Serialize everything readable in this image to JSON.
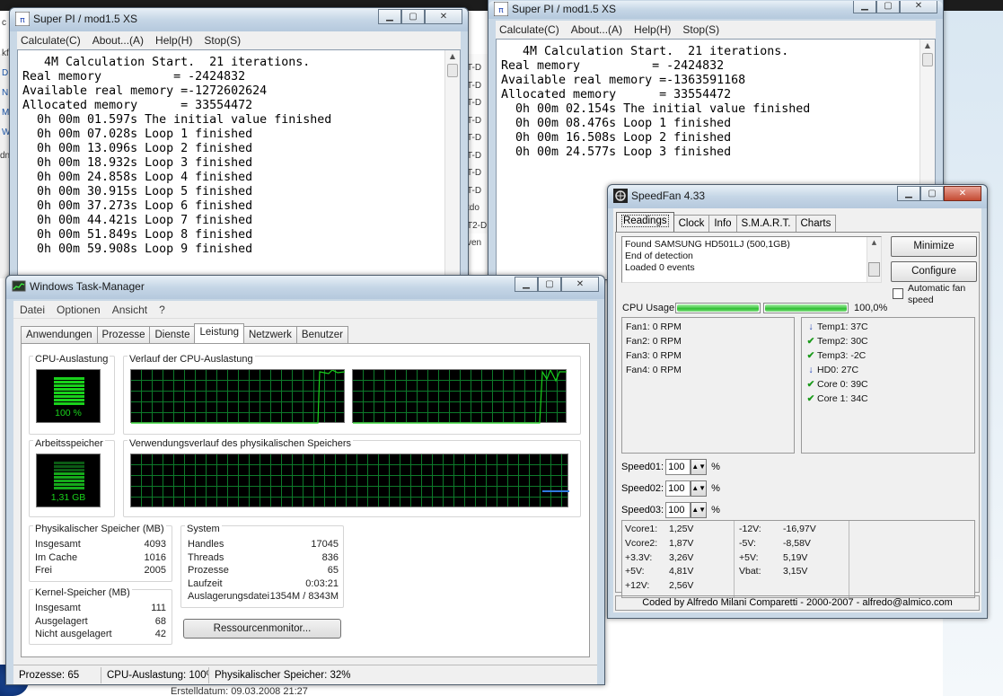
{
  "desktop": {
    "background_fragments": [
      "c",
      "kf",
      "D",
      "N",
      "M",
      "W",
      "dn"
    ],
    "mid_fragments": [
      "T-D",
      "T-D",
      "T-D",
      "T-D",
      "T-D",
      "T-D",
      "T-D",
      "T-D",
      "tdo",
      "T2-D",
      "ven"
    ],
    "footer_text": "Erstelldatum: 09.03.2008 21:27"
  },
  "superpi_1": {
    "title": "Super PI / mod1.5 XS",
    "menu": [
      "Calculate(C)",
      "About...(A)",
      "Help(H)",
      "Stop(S)"
    ],
    "lines": [
      "   4M Calculation Start.  21 iterations.",
      "Real memory          = -2424832",
      "Available real memory =-1272602624",
      "Allocated memory      = 33554472",
      "  0h 00m 01.597s The initial value finished",
      "  0h 00m 07.028s Loop 1 finished",
      "  0h 00m 13.096s Loop 2 finished",
      "  0h 00m 18.932s Loop 3 finished",
      "  0h 00m 24.858s Loop 4 finished",
      "  0h 00m 30.915s Loop 5 finished",
      "  0h 00m 37.273s Loop 6 finished",
      "  0h 00m 44.421s Loop 7 finished",
      "  0h 00m 51.849s Loop 8 finished",
      "  0h 00m 59.908s Loop 9 finished"
    ]
  },
  "superpi_2": {
    "title": "Super PI / mod1.5 XS",
    "menu": [
      "Calculate(C)",
      "About...(A)",
      "Help(H)",
      "Stop(S)"
    ],
    "lines": [
      "   4M Calculation Start.  21 iterations.",
      "Real memory          = -2424832",
      "Available real memory =-1363591168",
      "Allocated memory      = 33554472",
      "  0h 00m 02.154s The initial value finished",
      "  0h 00m 08.476s Loop 1 finished",
      "  0h 00m 16.508s Loop 2 finished",
      "  0h 00m 24.577s Loop 3 finished"
    ]
  },
  "taskmgr": {
    "title": "Windows Task-Manager",
    "menu": [
      "Datei",
      "Optionen",
      "Ansicht",
      "?"
    ],
    "tabs": [
      "Anwendungen",
      "Prozesse",
      "Dienste",
      "Leistung",
      "Netzwerk",
      "Benutzer"
    ],
    "active_tab": "Leistung",
    "cpu_label": "CPU-Auslastung",
    "cpu_value": "100 %",
    "cpu_fraction": 1.0,
    "cpu_history_label": "Verlauf der CPU-Auslastung",
    "mem_label": "Arbeitsspeicher",
    "mem_value": "1,31 GB",
    "mem_history_label": "Verwendungsverlauf des physikalischen Speichers",
    "phys": {
      "label": "Physikalischer Speicher (MB)",
      "rows": [
        [
          "Insgesamt",
          "4093"
        ],
        [
          "Im Cache",
          "1016"
        ],
        [
          "Frei",
          "2005"
        ]
      ]
    },
    "kernel": {
      "label": "Kernel-Speicher (MB)",
      "rows": [
        [
          "Insgesamt",
          "111"
        ],
        [
          "Ausgelagert",
          "68"
        ],
        [
          "Nicht ausgelagert",
          "42"
        ]
      ]
    },
    "system": {
      "label": "System",
      "rows": [
        [
          "Handles",
          "17045"
        ],
        [
          "Threads",
          "836"
        ],
        [
          "Prozesse",
          "65"
        ],
        [
          "Laufzeit",
          "0:03:21"
        ],
        [
          "Auslagerungsdatei",
          "1354M / 8343M"
        ]
      ]
    },
    "resource_button": "Ressourcenmonitor...",
    "status": [
      "Prozesse: 65",
      "CPU-Auslastung: 100%",
      "Physikalischer Speicher: 32%"
    ]
  },
  "speedfan": {
    "title": "SpeedFan 4.33",
    "tabs": [
      "Readings",
      "Clock",
      "Info",
      "S.M.A.R.T.",
      "Charts"
    ],
    "active_tab": "Readings",
    "log": [
      "Found SAMSUNG HD501LJ (500,1GB)",
      "End of detection",
      "Loaded 0 events"
    ],
    "minimize_label": "Minimize",
    "configure_label": "Configure",
    "auto_fan_label": "Automatic fan speed",
    "cpu_usage_label": "CPU Usage",
    "cpu_usage_value": "100,0%",
    "cpu_usage_fraction": 1.0,
    "fans": [
      "Fan1: 0 RPM",
      "Fan2: 0 RPM",
      "Fan3: 0 RPM",
      "Fan4: 0 RPM"
    ],
    "temps": [
      {
        "icon": "arrow-down-icon",
        "text": "Temp1: 37C"
      },
      {
        "icon": "check-icon",
        "text": "Temp2: 30C"
      },
      {
        "icon": "check-icon",
        "text": "Temp3: -2C"
      },
      {
        "icon": "arrow-down-icon",
        "text": "HD0:    27C"
      },
      {
        "icon": "check-icon",
        "text": "Core 0:  39C"
      },
      {
        "icon": "check-icon",
        "text": "Core 1:  34C"
      }
    ],
    "speeds": [
      {
        "label": "Speed01:",
        "value": "100"
      },
      {
        "label": "Speed02:",
        "value": "100"
      },
      {
        "label": "Speed03:",
        "value": "100"
      }
    ],
    "percent_sign": "%",
    "voltages_left": [
      [
        "Vcore1:",
        "1,25V"
      ],
      [
        "Vcore2:",
        "1,87V"
      ],
      [
        "+3.3V:",
        "3,26V"
      ],
      [
        "+5V:",
        "4,81V"
      ],
      [
        "+12V:",
        "2,56V"
      ]
    ],
    "voltages_right": [
      [
        "-12V:",
        "-16,97V"
      ],
      [
        "-5V:",
        "-8,58V"
      ],
      [
        "+5V:",
        "5,19V"
      ],
      [
        "Vbat:",
        "3,15V"
      ]
    ],
    "footer": "Coded by Alfredo Milani Comparetti - 2000-2007 - alfredo@almico.com",
    "accent_green": "#2fbf32",
    "arrow_color": "#1f3fb5",
    "check_color": "#1a9a1a"
  }
}
